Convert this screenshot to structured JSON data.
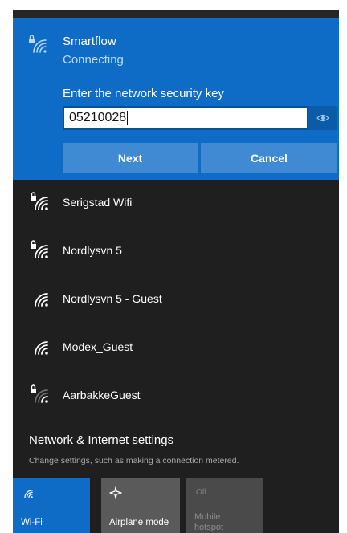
{
  "selected_network": {
    "name": "Smartflow",
    "status": "Connecting",
    "key_label": "Enter the network security key",
    "key_value": "05210028",
    "next_label": "Next",
    "cancel_label": "Cancel",
    "icon": "wifi-secured-icon"
  },
  "networks": [
    {
      "name": "Serigstad Wifi",
      "secured": true,
      "icon": "wifi-secured-icon"
    },
    {
      "name": "Nordlysvn 5",
      "secured": true,
      "icon": "wifi-secured-icon"
    },
    {
      "name": "Nordlysvn 5 - Guest",
      "secured": false,
      "icon": "wifi-icon"
    },
    {
      "name": "Modex_Guest",
      "secured": false,
      "icon": "wifi-icon"
    },
    {
      "name": "AarbakkeGuest",
      "secured": true,
      "icon": "wifi-secured-icon"
    }
  ],
  "settings": {
    "title": "Network & Internet settings",
    "subtitle": "Change settings, such as making a connection metered."
  },
  "quick_actions": [
    {
      "label": "Wi-Fi",
      "active": true,
      "icon": "wifi-icon"
    },
    {
      "label": "Airplane mode",
      "active": false,
      "icon": "airplane-icon"
    },
    {
      "label": "Mobile hotspot",
      "label_line1": "Mobile",
      "label_line2": "hotspot",
      "top_text": "Off",
      "disabled": true,
      "icon": "hotspot-icon"
    }
  ],
  "colors": {
    "accent": "#0f6cc6",
    "background": "#1f1f1f",
    "button": "#3f8ad2",
    "tile_inactive": "#5a5a5a"
  }
}
